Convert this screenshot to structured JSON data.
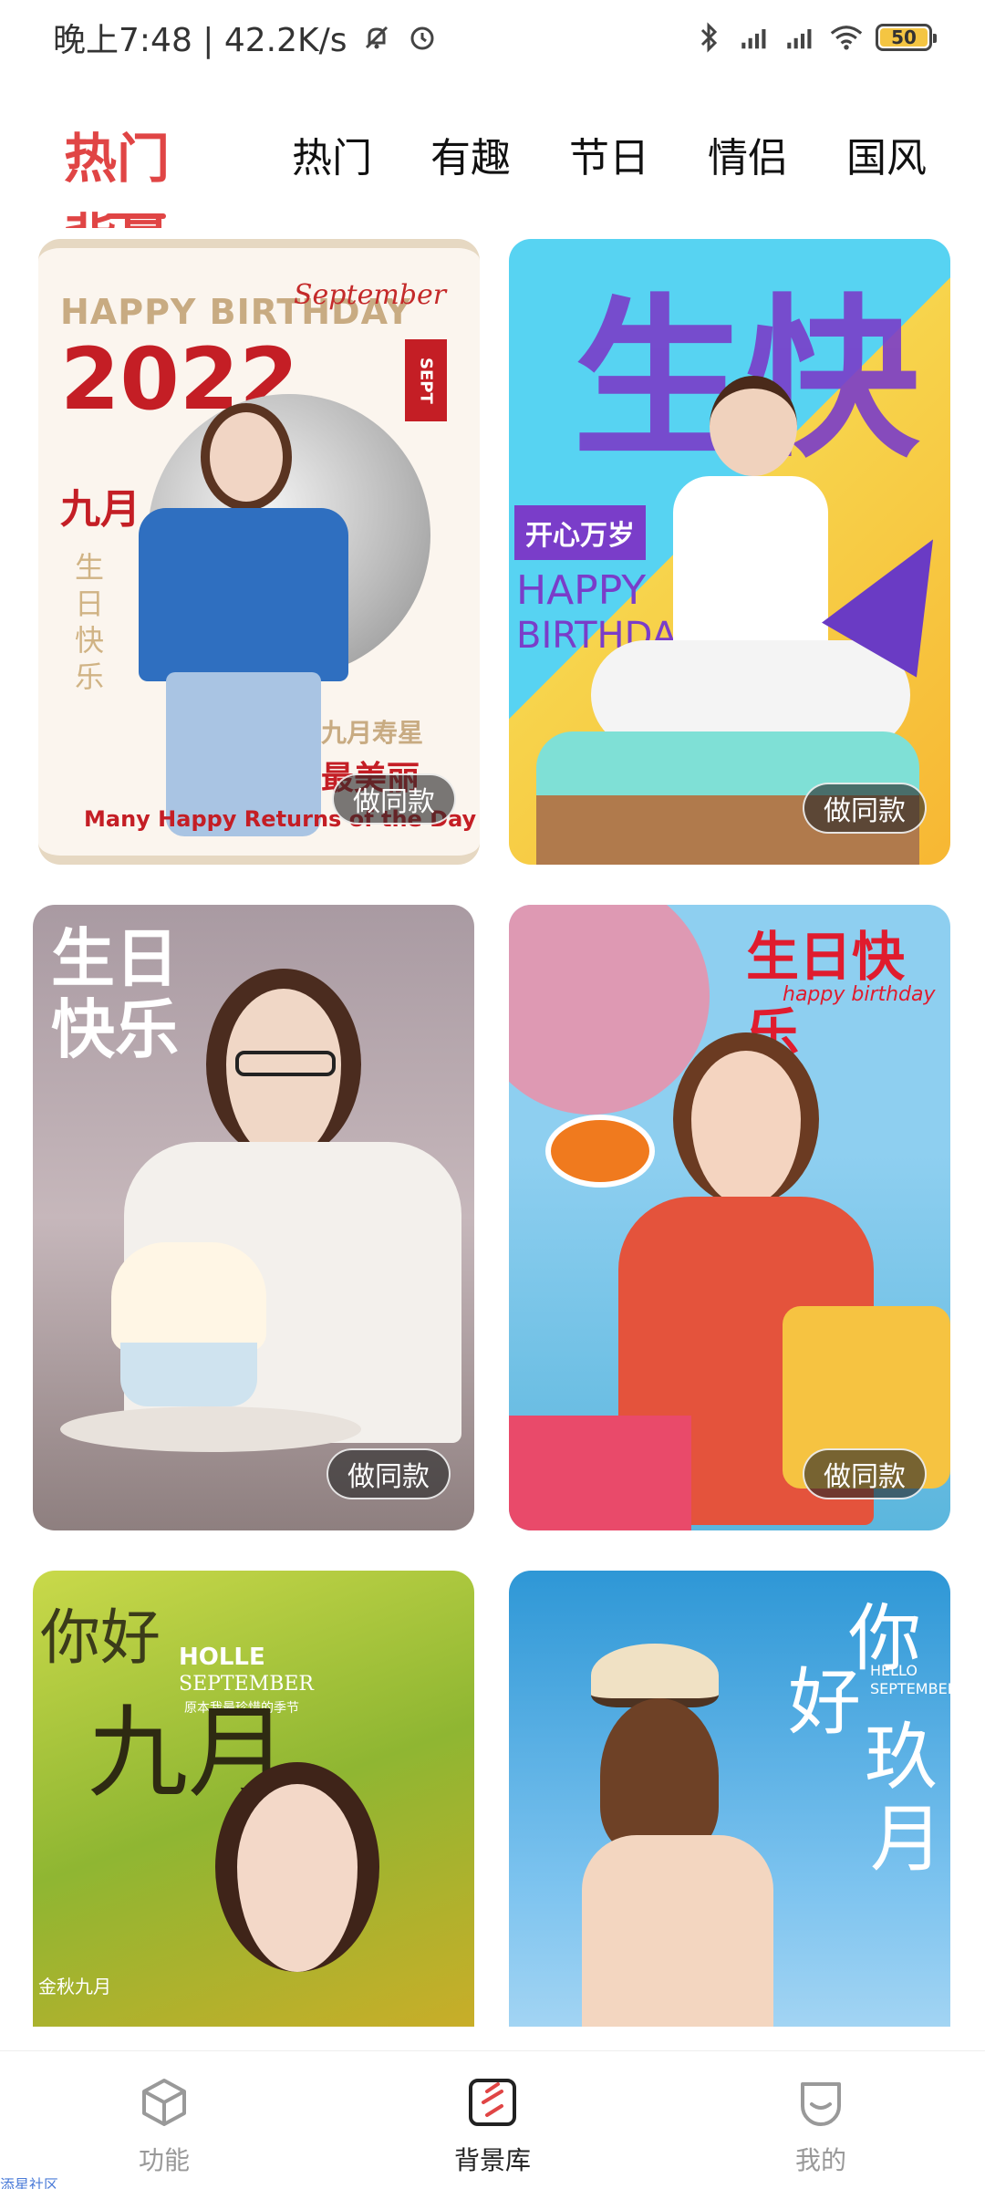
{
  "status": {
    "time_speed": "晚上7:48 | 42.2K/s",
    "battery": "50"
  },
  "tabs": {
    "active": "热门背景",
    "items": [
      "热门",
      "有趣",
      "节日",
      "情侣",
      "国风"
    ]
  },
  "cards": [
    {
      "top_text": "HAPPY BIRTHDAY",
      "script_text": "September",
      "year": "2022",
      "sept_tag": "SEPT",
      "month_text": "九月",
      "side_text": "生日快乐",
      "star_text": "九月寿星",
      "beauty_text": "最美丽",
      "bottom_text": "Many Happy Returns of the Day",
      "button": "做同款"
    },
    {
      "big_text": "生快",
      "badge_text": "开心万岁",
      "hb1": "HAPPY",
      "hb2": "BIRTHDAY",
      "button": "做同款"
    },
    {
      "script_text": "生日快乐",
      "button": "做同款"
    },
    {
      "title_text": "生日快乐",
      "subtitle_text": "happy birthday",
      "button": "做同款"
    },
    {
      "hello_text": "你好",
      "holle": "HOLLE",
      "sept": "SEPTEMBER",
      "small_line": "原本我最珍惜的季节",
      "big_text": "九月",
      "bottom_text": "金秋九月"
    },
    {
      "ni_text": "你",
      "hao_text": "好",
      "jiu_text": "玖",
      "yue_text": "月",
      "hello": "HELLO",
      "september": "SEPTEMBER"
    }
  ],
  "nav": {
    "items": [
      {
        "label": "功能"
      },
      {
        "label": "背景库"
      },
      {
        "label": "我的"
      }
    ]
  },
  "corner_note": "添星社区",
  "colors": {
    "accent": "#e04545",
    "nav_inactive": "#999999"
  }
}
